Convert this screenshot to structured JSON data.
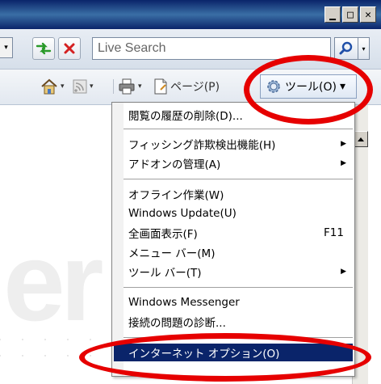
{
  "title_bar": {
    "buttons": [
      {
        "name": "minimize",
        "glyph": "▁"
      },
      {
        "name": "maximize",
        "glyph": "□"
      },
      {
        "name": "close",
        "glyph": "✕"
      }
    ]
  },
  "address_bar": {
    "dropdown_glyph": "▾",
    "refresh_glyph": "⇆",
    "stop_glyph": "✕",
    "search_placeholder": "Live Search",
    "search_drop_glyph": "▾"
  },
  "command_bar": {
    "page_label": "ページ(P)",
    "tools_label": "ツール(O)",
    "arrow_glyph": "▾"
  },
  "background": {
    "large_text": "er"
  },
  "tools_menu": {
    "items": [
      {
        "label": "閲覧の履歴の削除(D)...",
        "shortcut": "",
        "submenu": false
      },
      {
        "label": "フィッシング詐欺検出機能(H)",
        "shortcut": "",
        "submenu": true
      },
      {
        "label": "アドオンの管理(A)",
        "shortcut": "",
        "submenu": true
      },
      {
        "label": "オフライン作業(W)",
        "shortcut": "",
        "submenu": false
      },
      {
        "label": "Windows Update(U)",
        "shortcut": "",
        "submenu": false
      },
      {
        "label": "全画面表示(F)",
        "shortcut": "F11",
        "submenu": false
      },
      {
        "label": "メニュー バー(M)",
        "shortcut": "",
        "submenu": false
      },
      {
        "label": "ツール バー(T)",
        "shortcut": "",
        "submenu": true
      },
      {
        "label": "Windows Messenger",
        "shortcut": "",
        "submenu": false
      },
      {
        "label": "接続の問題の診断...",
        "shortcut": "",
        "submenu": false
      },
      {
        "label": "インターネット オプション(O)",
        "shortcut": "",
        "submenu": false,
        "highlighted": true
      }
    ],
    "submenu_glyph": "▶"
  },
  "colors": {
    "highlight": "#0a246a",
    "annotation_red": "#e60000",
    "titlebar": "#0a246a"
  }
}
